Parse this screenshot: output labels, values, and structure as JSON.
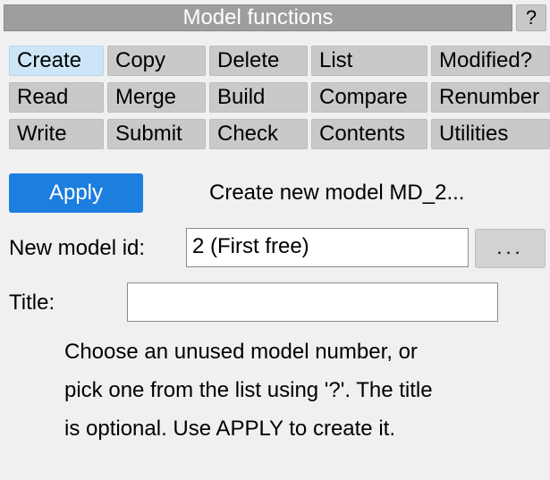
{
  "panel": {
    "title": "Model functions",
    "help_label": "?"
  },
  "tabs": {
    "selected": "Create",
    "rows": [
      [
        "Create",
        "Copy",
        "Delete",
        "List",
        "Modified?"
      ],
      [
        "Read",
        "Merge",
        "Build",
        "Compare",
        "Renumber"
      ],
      [
        "Write",
        "Submit",
        "Check",
        "Contents",
        "Utilities"
      ]
    ]
  },
  "action": {
    "apply_label": "Apply",
    "status": "Create new model MD_2..."
  },
  "form": {
    "model_id_label": "New model id:",
    "model_id_value": "2 (First free)",
    "picker_label": "...",
    "title_label": "Title:",
    "title_value": ""
  },
  "help": {
    "lines": [
      "Choose an unused model number, or",
      "pick one from the list using '?'. The title",
      "is optional. Use APPLY to create it."
    ]
  }
}
